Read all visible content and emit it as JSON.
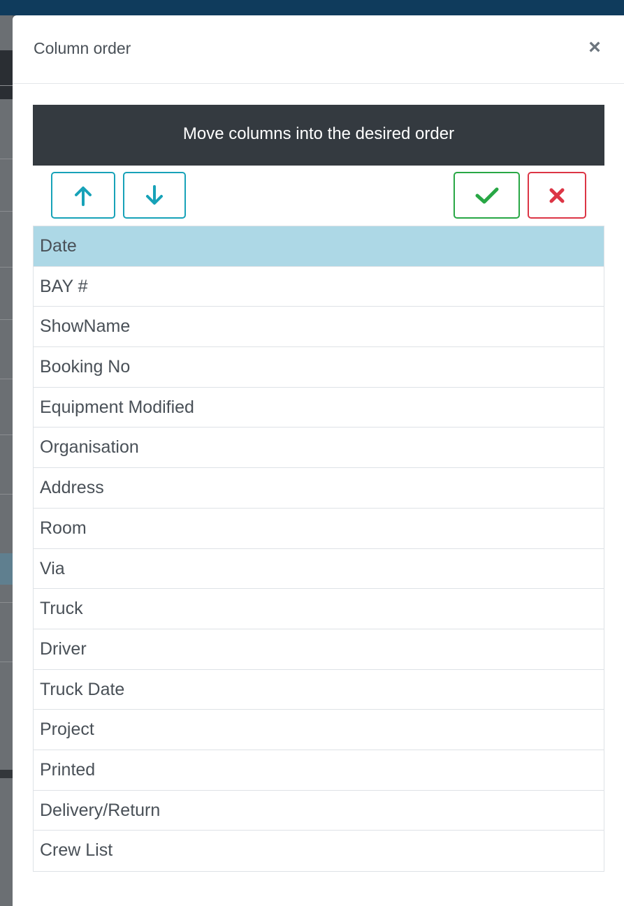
{
  "modal": {
    "title": "Column order",
    "close_label": "×",
    "banner": "Move columns into the desired order"
  },
  "colors": {
    "info": "#17a2b8",
    "success": "#28a745",
    "danger": "#dc3545",
    "selected_row": "#add8e6",
    "banner_bg": "#343a40"
  },
  "toolbar": {
    "up_icon": "arrow-up-icon",
    "down_icon": "arrow-down-icon",
    "confirm_icon": "checkmark-icon",
    "cancel_icon": "x-icon"
  },
  "columns": {
    "selected": "Date",
    "items": [
      "Date",
      "BAY #",
      "ShowName",
      "Booking No",
      "Equipment Modified",
      "Organisation",
      "Address",
      "Room",
      "Via",
      "Truck",
      "Driver",
      "Truck Date",
      "Project",
      "Printed",
      "Delivery/Return",
      "Crew List"
    ]
  }
}
